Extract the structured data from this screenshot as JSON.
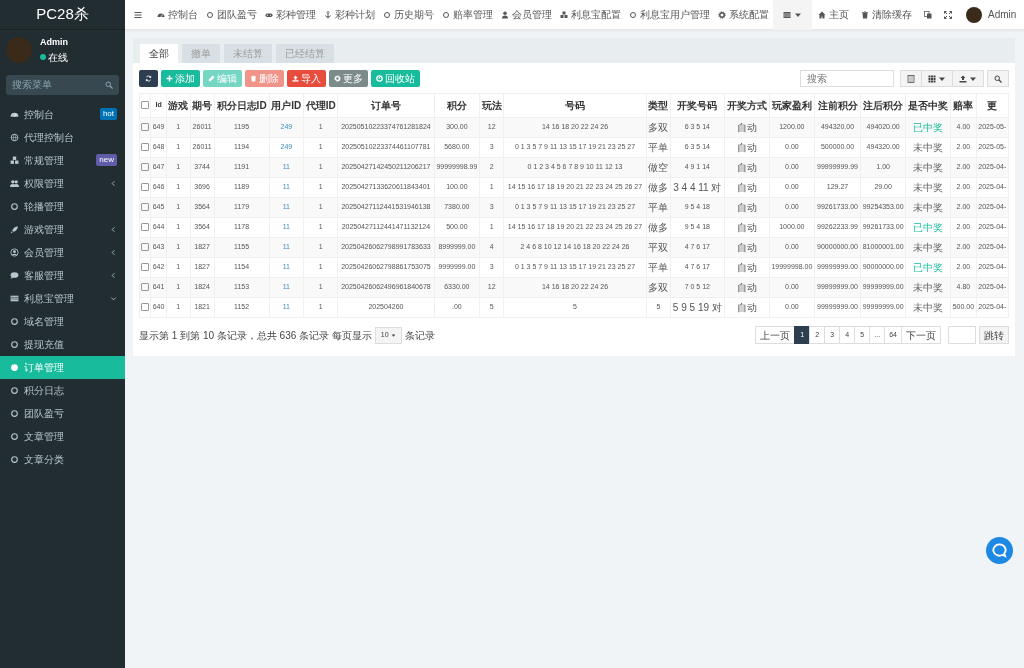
{
  "sidebar": {
    "title": "PC28杀",
    "user": {
      "name": "Admin",
      "status": "在线"
    },
    "search": {
      "placeholder": "搜索菜单"
    },
    "items": [
      {
        "label": "控制台",
        "badge": {
          "text": "hot",
          "color": "#0073b7"
        },
        "selected": false
      },
      {
        "label": "代理控制台",
        "selected": false
      },
      {
        "label": "常规管理",
        "badge": {
          "text": "new",
          "color": "#605ca8"
        },
        "selected": false
      },
      {
        "label": "权限管理",
        "expanded": false,
        "selected": false
      },
      {
        "label": "轮播管理",
        "selected": false
      },
      {
        "label": "游戏管理",
        "expanded": false,
        "selected": false
      },
      {
        "label": "会员管理",
        "expanded": false,
        "selected": false
      },
      {
        "label": "客服管理",
        "expanded": false,
        "selected": false
      },
      {
        "label": "利息宝管理",
        "expanded": true,
        "selected": false
      },
      {
        "label": "域名管理",
        "selected": false
      },
      {
        "label": "提现充值",
        "selected": false
      },
      {
        "label": "订单管理",
        "selected": true
      },
      {
        "label": "积分日志",
        "selected": false
      },
      {
        "label": "团队盈亏",
        "selected": false
      },
      {
        "label": "文章管理",
        "selected": false
      },
      {
        "label": "文章分类",
        "selected": false
      }
    ]
  },
  "topnav": {
    "items": [
      {
        "label": "控制台"
      },
      {
        "label": "团队盈亏"
      },
      {
        "label": "彩种管理"
      },
      {
        "label": "彩种计划"
      },
      {
        "label": "历史期号"
      },
      {
        "label": "赔率管理"
      },
      {
        "label": "会员管理"
      },
      {
        "label": "利息宝配置"
      },
      {
        "label": "利息宝用户管理"
      },
      {
        "label": "系统配置"
      }
    ],
    "right": [
      {
        "label": "主页"
      },
      {
        "label": "清除缓存"
      }
    ],
    "user": "Admin"
  },
  "tabs": [
    {
      "label": "全部",
      "selected": true
    },
    {
      "label": "撤单",
      "selected": false
    },
    {
      "label": "未结算",
      "selected": false
    },
    {
      "label": "已经结算",
      "selected": false
    }
  ],
  "toolbar": {
    "buttons": [
      {
        "kind": "refresh",
        "disabled": false
      },
      {
        "kind": "add",
        "label": "添加",
        "disabled": false
      },
      {
        "kind": "edit",
        "label": "编辑",
        "disabled": true
      },
      {
        "kind": "delete",
        "label": "删除",
        "disabled": true
      },
      {
        "kind": "import",
        "label": "导入",
        "disabled": false
      },
      {
        "kind": "more",
        "label": "更多",
        "disabled": false
      },
      {
        "kind": "recycle",
        "label": "回收站",
        "disabled": false
      }
    ],
    "search": {
      "placeholder": "搜索"
    }
  },
  "table": {
    "select_all": {
      "checked": false
    },
    "columns": [
      {
        "label": "Id"
      },
      {
        "label": "游戏"
      },
      {
        "label": "期号"
      },
      {
        "label": "积分日志ID"
      },
      {
        "label": "用户ID",
        "kind": "link"
      },
      {
        "label": "代理ID"
      },
      {
        "label": "订单号"
      },
      {
        "label": "积分"
      },
      {
        "label": "玩法"
      },
      {
        "label": "号码"
      },
      {
        "label": "类型"
      },
      {
        "label": "开奖号码"
      },
      {
        "label": "开奖方式"
      },
      {
        "label": "玩家盈利"
      },
      {
        "label": "注前积分"
      },
      {
        "label": "注后积分"
      },
      {
        "label": "是否中奖",
        "kind": "status"
      },
      {
        "label": "赔率"
      },
      {
        "label": "更"
      }
    ],
    "rows": [
      {
        "checked": false,
        "won": true,
        "cells": [
          "649",
          "1",
          "26011",
          "1195",
          "249",
          "1",
          "20250510223374761281824",
          "300.00",
          "12",
          "14 16 18 20 22 24 26",
          "多双",
          "6 3 5 14",
          "自动",
          "1200.00",
          "494320.00",
          "494020.00",
          "已中奖",
          "4.00",
          "2025-05-"
        ]
      },
      {
        "checked": false,
        "won": false,
        "cells": [
          "648",
          "1",
          "26011",
          "1194",
          "249",
          "1",
          "20250510223374461107781",
          "5680.00",
          "3",
          "0 1 3 5 7 9 11 13 15 17 19 21 23 25 27",
          "平单",
          "6 3 5 14",
          "自动",
          "0.00",
          "500000.00",
          "494320.00",
          "未中奖",
          "2.00",
          "2025-05-"
        ]
      },
      {
        "checked": false,
        "won": false,
        "cells": [
          "647",
          "1",
          "3744",
          "1191",
          "11",
          "1",
          "20250427142450211206217",
          "99999998.99",
          "2",
          "0 1 2 3 4 5 6 7 8 9 10 11 12 13",
          "做空",
          "4 9 1 14",
          "自动",
          "0.00",
          "99999999.99",
          "1.00",
          "未中奖",
          "2.00",
          "2025-04-"
        ]
      },
      {
        "checked": false,
        "won": false,
        "cells": [
          "646",
          "1",
          "3696",
          "1189",
          "11",
          "1",
          "20250427133620611843401",
          "100.00",
          "1",
          "14 15 16 17 18 19 20 21 22 23 24 25 26 27",
          "做多",
          "3 4 4 11 对",
          "自动",
          "0.00",
          "129.27",
          "29.00",
          "未中奖",
          "2.00",
          "2025-04-"
        ]
      },
      {
        "checked": false,
        "won": false,
        "cells": [
          "645",
          "1",
          "3564",
          "1179",
          "11",
          "1",
          "20250427112441531946138",
          "7380.00",
          "3",
          "0 1 3 5 7 9 11 13 15 17 19 21 23 25 27",
          "平单",
          "9 5 4 18",
          "自动",
          "0.00",
          "99261733.00",
          "99254353.00",
          "未中奖",
          "2.00",
          "2025-04-"
        ]
      },
      {
        "checked": false,
        "won": true,
        "cells": [
          "644",
          "1",
          "3564",
          "1178",
          "11",
          "1",
          "20250427112441471132124",
          "500.00",
          "1",
          "14 15 16 17 18 19 20 21 22 23 24 25 26 27",
          "做多",
          "9 5 4 18",
          "自动",
          "1000.00",
          "99262233.99",
          "99261733.00",
          "已中奖",
          "2.00",
          "2025-04-"
        ]
      },
      {
        "checked": false,
        "won": false,
        "cells": [
          "643",
          "1",
          "1827",
          "1155",
          "11",
          "1",
          "20250426062798991783633",
          "8999999.00",
          "4",
          "2 4 6 8 10 12 14 16 18 20 22 24 26",
          "平双",
          "4 7 6 17",
          "自动",
          "0.00",
          "90000000.00",
          "81000001.00",
          "未中奖",
          "2.00",
          "2025-04-"
        ]
      },
      {
        "checked": false,
        "won": true,
        "cells": [
          "642",
          "1",
          "1827",
          "1154",
          "11",
          "1",
          "20250426062798861753075",
          "9999999.00",
          "3",
          "0 1 3 5 7 9 11 13 15 17 19 21 23 25 27",
          "平单",
          "4 7 6 17",
          "自动",
          "19999998.00",
          "99999999.00",
          "90000000.00",
          "已中奖",
          "2.00",
          "2025-04-"
        ]
      },
      {
        "checked": false,
        "won": false,
        "cells": [
          "641",
          "1",
          "1824",
          "1153",
          "11",
          "1",
          "20250426062496961840678",
          "6330.00",
          "12",
          "14 16 18 20 22 24 26",
          "多双",
          "7 0 5 12",
          "自动",
          "0.00",
          "99999999.00",
          "99999999.00",
          "未中奖",
          "4.80",
          "2025-04-"
        ]
      },
      {
        "checked": false,
        "won": false,
        "cells": [
          "640",
          "1",
          "1821",
          "1152",
          "11",
          "1",
          "202504260",
          ".00",
          "5",
          "5",
          "5",
          "5 9 5 19 对",
          "自动",
          "0.00",
          "99999999.00",
          "99999999.00",
          "未中奖",
          "500.00",
          "2025-04-"
        ]
      }
    ]
  },
  "pagination": {
    "info": "显示第 1 到第 10 条记录，总共 636 条记录 每页显示",
    "page_size": "10",
    "suffix": "条记录",
    "pages": [
      {
        "label": "上一页",
        "selected": false
      },
      {
        "label": "1",
        "selected": true
      },
      {
        "label": "2",
        "selected": false
      },
      {
        "label": "3",
        "selected": false
      },
      {
        "label": "4",
        "selected": false
      },
      {
        "label": "5",
        "selected": false
      },
      {
        "label": "...",
        "selected": false
      },
      {
        "label": "64",
        "selected": false
      },
      {
        "label": "下一页",
        "selected": false
      }
    ],
    "jump": "跳转"
  }
}
